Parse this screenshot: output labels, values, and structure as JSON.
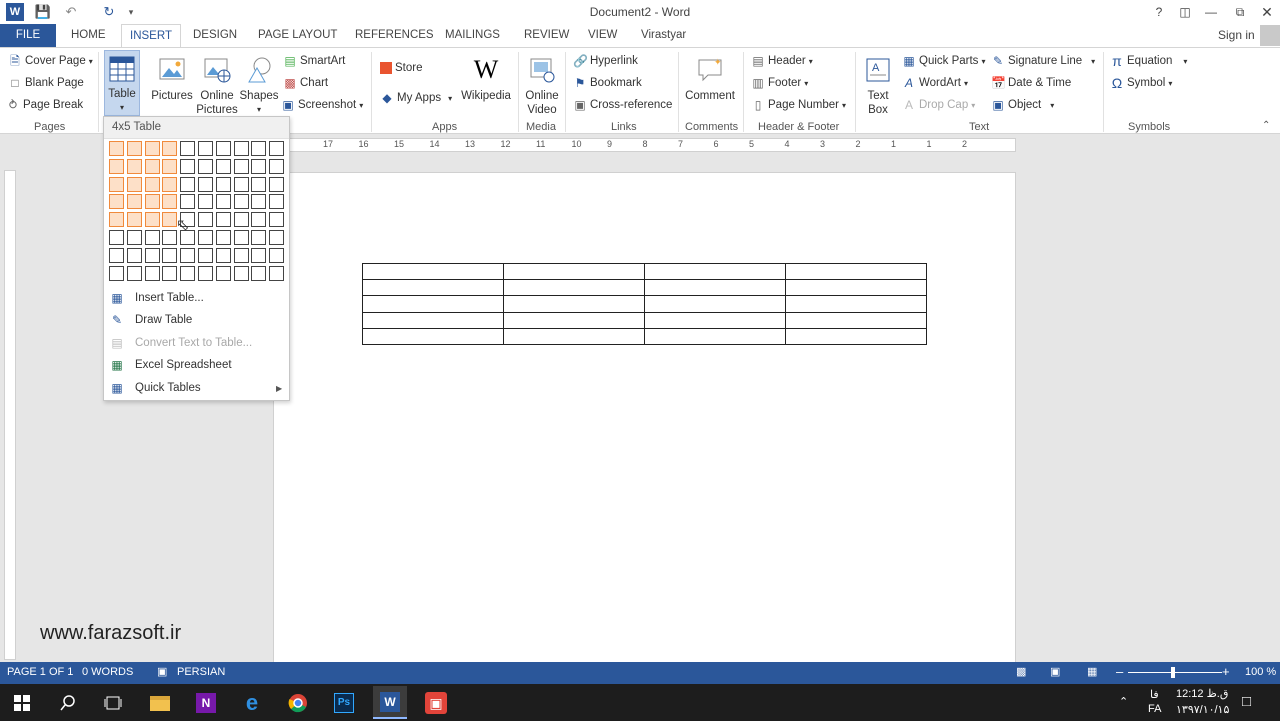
{
  "window": {
    "title": "Document2 - Word",
    "help": "?",
    "sign_in": "Sign in"
  },
  "tabs": [
    "FILE",
    "HOME",
    "INSERT",
    "DESIGN",
    "PAGE LAYOUT",
    "REFERENCES",
    "MAILINGS",
    "REVIEW",
    "VIEW",
    "Virastyar"
  ],
  "ribbon": {
    "pages": {
      "cover_page": "Cover Page",
      "blank_page": "Blank Page",
      "page_break": "Page Break",
      "label": "Pages"
    },
    "tables": {
      "table": "Table"
    },
    "illustrations": {
      "pictures": "Pictures",
      "online_pictures": "Online Pictures",
      "shapes": "Shapes",
      "smartart": "SmartArt",
      "chart": "Chart",
      "screenshot": "Screenshot"
    },
    "apps": {
      "store": "Store",
      "my_apps": "My Apps",
      "wikipedia": "Wikipedia",
      "label": "Apps"
    },
    "media": {
      "online_video": "Online Video",
      "label": "Media"
    },
    "links": {
      "hyperlink": "Hyperlink",
      "bookmark": "Bookmark",
      "cross_reference": "Cross-reference",
      "label": "Links"
    },
    "comments": {
      "comment": "Comment",
      "label": "Comments"
    },
    "header_footer": {
      "header": "Header",
      "footer": "Footer",
      "page_number": "Page Number",
      "label": "Header & Footer"
    },
    "text": {
      "text_box": "Text Box",
      "quick_parts": "Quick Parts",
      "wordart": "WordArt",
      "drop_cap": "Drop Cap",
      "signature_line": "Signature Line",
      "date_time": "Date & Time",
      "object": "Object",
      "label": "Text"
    },
    "symbols": {
      "equation": "Equation",
      "symbol": "Symbol",
      "label": "Symbols"
    }
  },
  "dropdown": {
    "header": "4x5 Table",
    "grid_cols": 10,
    "grid_rows": 8,
    "sel_cols": 4,
    "sel_rows": 5,
    "items": [
      {
        "label": "Insert Table...",
        "enabled": true
      },
      {
        "label": "Draw Table",
        "enabled": true
      },
      {
        "label": "Convert Text to Table...",
        "enabled": false
      },
      {
        "label": "Excel Spreadsheet",
        "enabled": true
      },
      {
        "label": "Quick Tables",
        "enabled": true
      }
    ]
  },
  "ruler": {
    "numbers": [
      "17",
      "16",
      "15",
      "14",
      "13",
      "12",
      "11",
      "10",
      "9",
      "8",
      "7",
      "6",
      "5",
      "4",
      "3",
      "2",
      "1",
      "1",
      "2"
    ]
  },
  "document": {
    "table_rows": 5,
    "table_cols": 4
  },
  "status": {
    "page": "PAGE 1 OF 1",
    "words": "0 WORDS",
    "language": "PERSIAN",
    "zoom": "100 %"
  },
  "watermark": "www.farazsoft.ir",
  "taskbar": {
    "lang_top": "فا",
    "lang": "FA",
    "time": "ق.ظ 12:12",
    "date": "۱۳۹۷/۱۰/۱۵"
  }
}
